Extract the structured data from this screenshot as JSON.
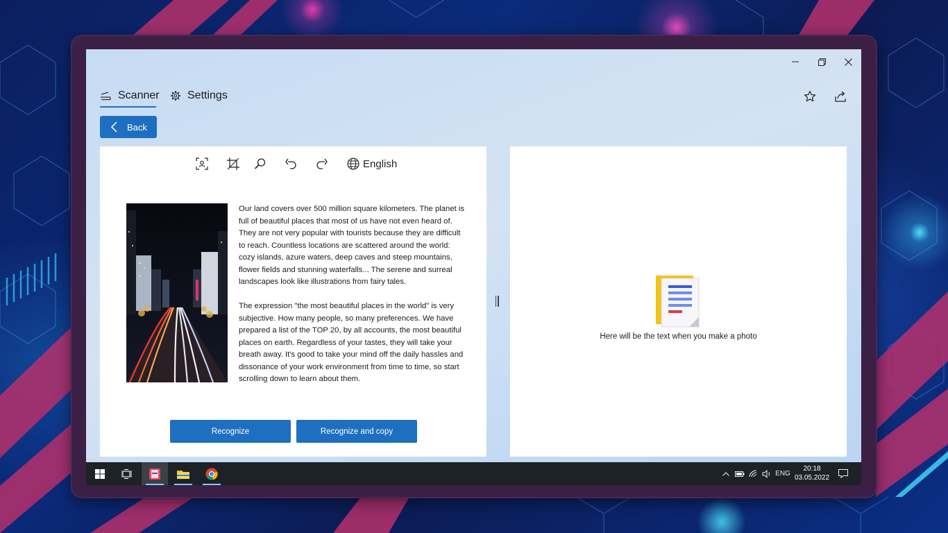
{
  "window": {
    "controls": {
      "minimize_icon": "minimize-icon",
      "restore_icon": "restore-icon",
      "close_icon": "close-icon"
    }
  },
  "nav": {
    "tabs": [
      {
        "label": "Scanner",
        "icon": "scanner-icon",
        "active": true
      },
      {
        "label": "Settings",
        "icon": "gear-icon",
        "active": false
      }
    ],
    "favorite_icon": "star-icon",
    "share_icon": "share-icon"
  },
  "back_button": {
    "label": "Back",
    "icon": "chevron-left-icon"
  },
  "toolbar": {
    "tools": [
      "select-area-icon",
      "crop-icon",
      "zoom-icon",
      "undo-icon",
      "redo-icon"
    ],
    "language": "English",
    "language_icon": "globe-icon"
  },
  "document": {
    "paragraphs": [
      "Our land covers over 500 million square kilometers. The planet is full of beautiful places that most of us have not even heard of. They are not very popular with tourists because they are difficult to reach. Countless locations are scattered around the world: cozy islands, azure waters, deep caves and steep mountains, flower fields and stunning waterfalls... The serene and surreal landscapes look like illustrations from fairy tales.",
      "The expression \"the most beautiful places in the world\" is very subjective. How many people, so many preferences. We have prepared a list of the TOP 20, by all accounts, the most beautiful places on earth. Regardless of your tastes, they will take your breath away. It's good to take your mind off the daily hassles and dissonance of your work environment from time to time, so start scrolling down to learn about them."
    ]
  },
  "actions": {
    "recognize": "Recognize",
    "recognize_copy": "Recognize and copy"
  },
  "result": {
    "placeholder": "Here will be the text when you make a photo",
    "icon": "document-icon"
  },
  "taskbar": {
    "apps": [
      "windows-start-icon",
      "task-view-icon",
      "scanner-app-icon",
      "file-explorer-icon",
      "chrome-icon"
    ],
    "tray": {
      "language": "ENG",
      "time": "20:18",
      "date": "03.05.2022"
    },
    "accent": "#1f6fc1"
  }
}
